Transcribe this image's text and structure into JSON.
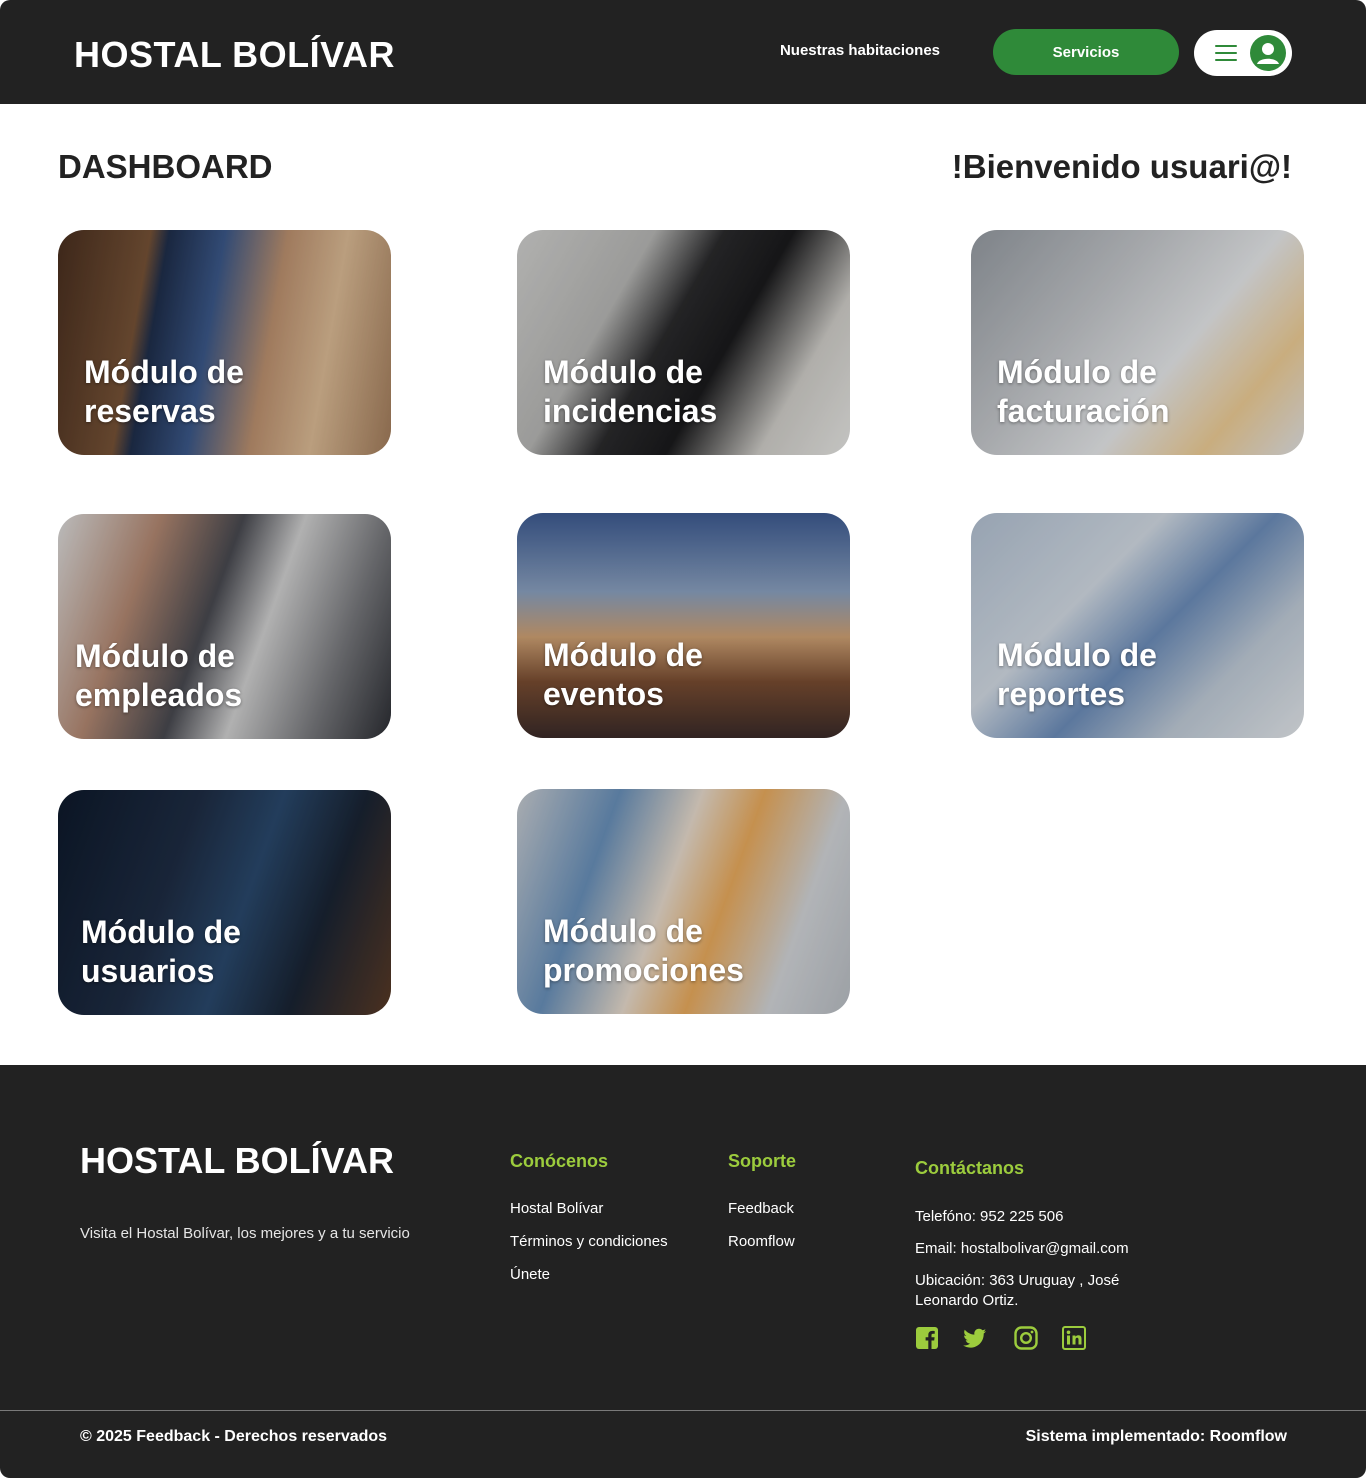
{
  "header": {
    "brand": "HOSTAL BOLÍVAR",
    "nav_rooms": "Nuestras habitaciones",
    "services_button": "Servicios",
    "menu_icon": "hamburger-icon",
    "avatar_icon": "user-avatar-icon"
  },
  "main": {
    "title": "DASHBOARD",
    "welcome": "!Bienvenido usuari@!"
  },
  "modules": [
    {
      "line1": "Módulo de",
      "line2": "reservas"
    },
    {
      "line1": "Módulo de",
      "line2": "incidencias"
    },
    {
      "line1": "Módulo de",
      "line2": "facturación"
    },
    {
      "line1": "Módulo de",
      "line2": "empleados"
    },
    {
      "line1": "Módulo de",
      "line2": "eventos"
    },
    {
      "line1": "Módulo de",
      "line2": "reportes"
    },
    {
      "line1": "Módulo de",
      "line2": "usuarios"
    },
    {
      "line1": "Módulo de",
      "line2": "promociones"
    }
  ],
  "footer": {
    "brand": "HOSTAL BOLÍVAR",
    "tagline": "Visita el Hostal Bolívar, los mejores y a tu servicio",
    "about": {
      "heading": "Conócenos",
      "links": [
        "Hostal Bolívar",
        "Términos y condiciones",
        "Únete"
      ]
    },
    "support": {
      "heading": "Soporte",
      "links": [
        "Feedback",
        "Roomflow"
      ]
    },
    "contact": {
      "heading": "Contáctanos",
      "phone": "Telefóno: 952 225 506",
      "email": "Email: hostalbolivar@gmail.com",
      "location_line1": "Ubicación: 363 Uruguay , José",
      "location_line2": "Leonardo Ortiz."
    },
    "social_icons": [
      "facebook-icon",
      "twitter-icon",
      "instagram-icon",
      "linkedin-icon"
    ],
    "copyright": "© 2025 Feedback - Derechos reservados",
    "system": "Sistema implementado: Roomflow"
  },
  "colors": {
    "primary_green": "#2f8a39",
    "accent_lime": "#9ccc3d",
    "dark": "#222222"
  }
}
